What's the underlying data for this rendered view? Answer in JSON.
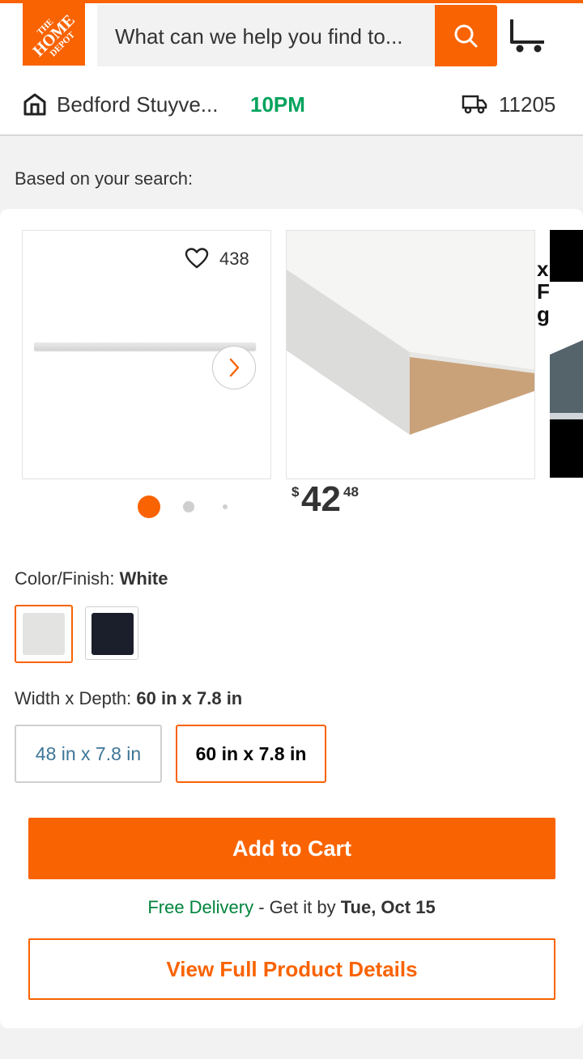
{
  "header": {
    "logo_text": [
      "THE",
      "HOME",
      "DEPOT"
    ],
    "search_placeholder": "What can we help you find to...",
    "store_name": "Bedford Stuyve...",
    "store_close_time": "10PM",
    "zip_code": "11205",
    "icons": [
      "search-icon",
      "cart-icon",
      "store-icon",
      "delivery-truck-icon"
    ]
  },
  "recommendations": {
    "heading": "Based on your search:",
    "item1": {
      "likes": "438"
    },
    "item2": {
      "price_currency": "$",
      "price_dollars": "42",
      "price_cents": "48"
    },
    "item3_partial_text": [
      "x",
      "F",
      "g"
    ],
    "carousel_pages": 3,
    "carousel_active_page": 1
  },
  "product": {
    "color_label": "Color/Finish:",
    "color_value": "White",
    "colors": [
      {
        "name": "White",
        "hex": "#e3e3e1",
        "selected": true
      },
      {
        "name": "Black",
        "hex": "#1b1f2b",
        "selected": false
      }
    ],
    "size_label": "Width x Depth:",
    "size_value": "60 in x 7.8 in",
    "sizes": [
      {
        "label": "48 in x 7.8 in",
        "selected": false
      },
      {
        "label": "60 in x 7.8 in",
        "selected": true
      }
    ],
    "add_to_cart": "Add to Cart",
    "delivery_free": "Free Delivery",
    "delivery_sep": " - Get it by ",
    "delivery_date": "Tue, Oct 15",
    "view_details": "View Full Product Details"
  },
  "colors": {
    "brand_orange": "#f96302",
    "store_green": "#00a35c",
    "delivery_green": "#00843d"
  }
}
